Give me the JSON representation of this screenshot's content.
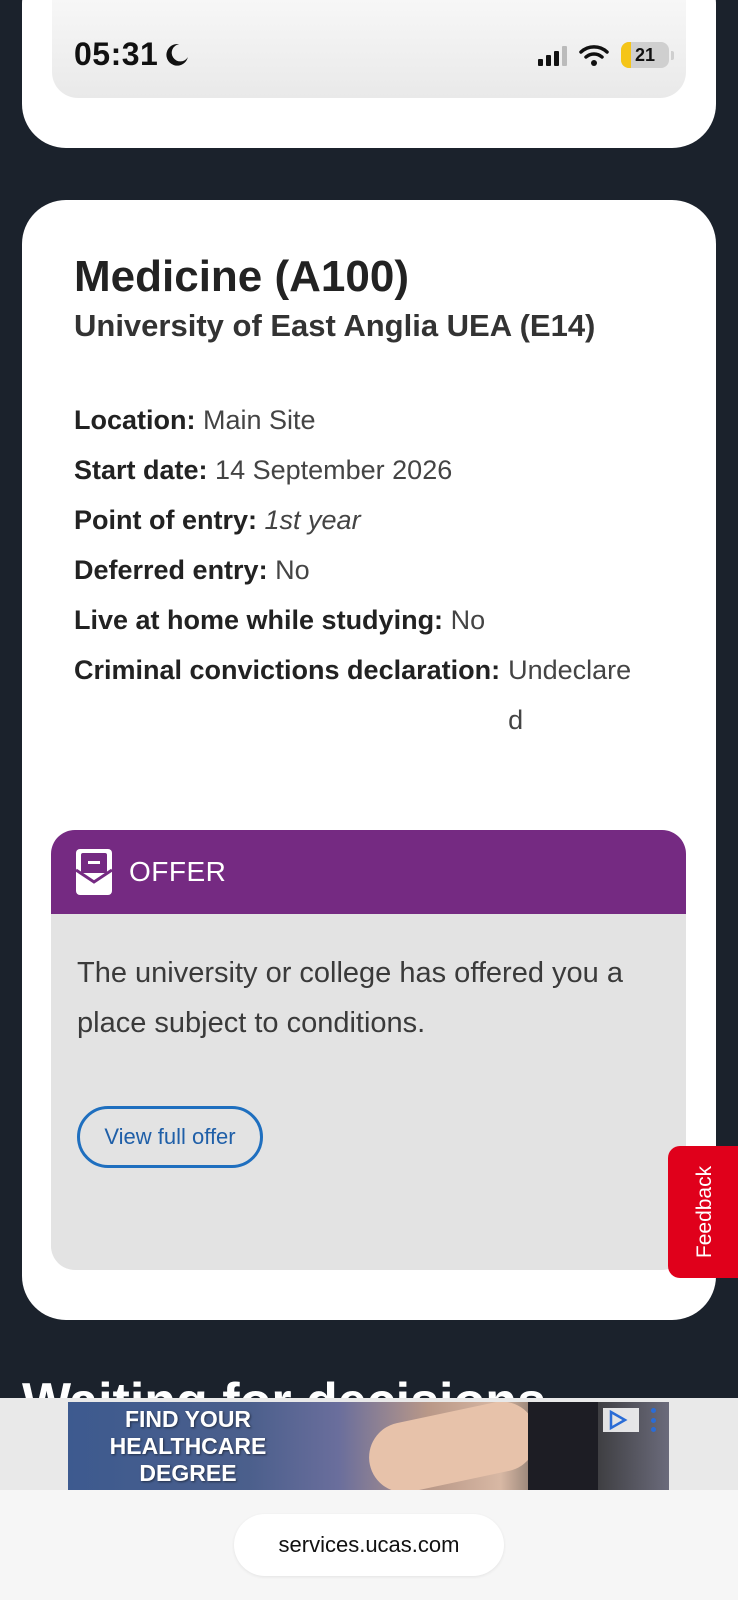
{
  "status_bar": {
    "time": "05:31",
    "battery": "21",
    "battery_level": 0.21
  },
  "course": {
    "title": "Medicine (A100)",
    "institution": "University of East Anglia UEA (E14)",
    "details": [
      {
        "label": "Location:",
        "value": "Main Site"
      },
      {
        "label": "Start date:",
        "value": "14 September 2026"
      },
      {
        "label": "Point of entry:",
        "value": "1st year"
      },
      {
        "label": "Deferred entry:",
        "value": "No"
      },
      {
        "label": "Live at home while studying:",
        "value": "No"
      },
      {
        "label": "Criminal convictions declaration:",
        "value": "Undeclared"
      }
    ]
  },
  "offer": {
    "status": "OFFER",
    "message": "The university or college has offered you a place subject to conditions.",
    "button_label": "View full offer",
    "header_color": "#752a82"
  },
  "feedback": {
    "label": "Feedback",
    "color": "#e0001b"
  },
  "section": {
    "heading": "Waiting for decisions"
  },
  "ad": {
    "text": "FIND YOUR HEALTHCARE DEGREE"
  },
  "browser": {
    "url": "services.ucas.com"
  }
}
